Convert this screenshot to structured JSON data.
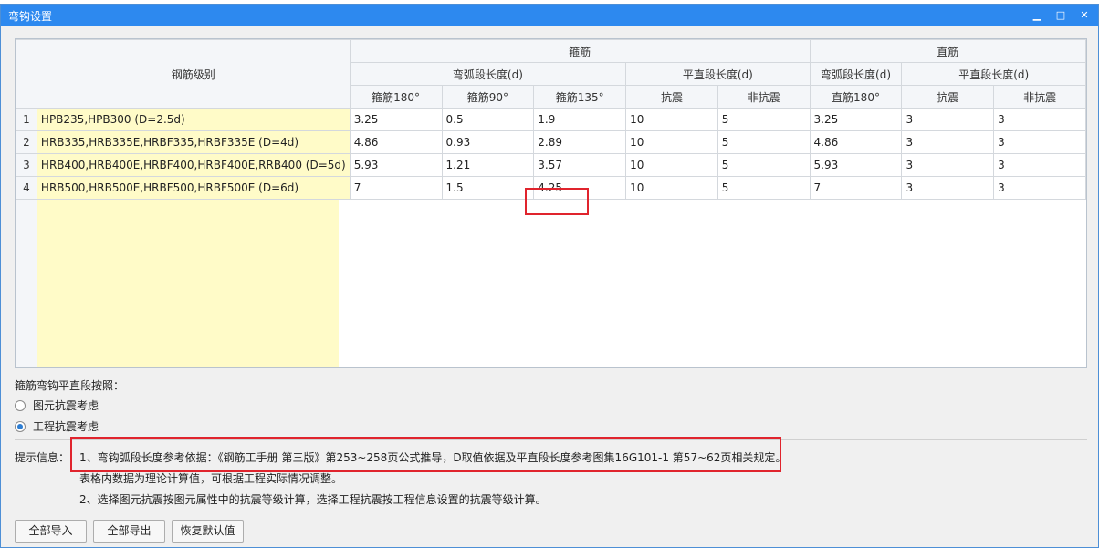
{
  "window": {
    "title": "弯钩设置",
    "min_icon": "minimize-icon",
    "max_icon": "maximize-icon",
    "close_icon": "close-icon"
  },
  "table": {
    "header_grade": "钢筋级别",
    "group_stirrup": "箍筋",
    "group_straight": "直筋",
    "sub_arc": "弯弧段长度(d)",
    "sub_flat": "平直段长度(d)",
    "sub_arc_straight": "弯弧段长度(d)",
    "sub_flat_straight": "平直段长度(d)",
    "columns": [
      "箍筋180°",
      "箍筋90°",
      "箍筋135°",
      "抗震",
      "非抗震",
      "直筋180°",
      "抗震",
      "非抗震"
    ],
    "rows": [
      {
        "num": "1",
        "grade": "HPB235,HPB300 (D=2.5d)",
        "values": [
          "3.25",
          "0.5",
          "1.9",
          "10",
          "5",
          "3.25",
          "3",
          "3"
        ]
      },
      {
        "num": "2",
        "grade": "HRB335,HRB335E,HRBF335,HRBF335E (D=4d)",
        "values": [
          "4.86",
          "0.93",
          "2.89",
          "10",
          "5",
          "4.86",
          "3",
          "3"
        ]
      },
      {
        "num": "3",
        "grade": "HRB400,HRB400E,HRBF400,HRBF400E,RRB400 (D=5d)",
        "values": [
          "5.93",
          "1.21",
          "3.57",
          "10",
          "5",
          "5.93",
          "3",
          "3"
        ]
      },
      {
        "num": "4",
        "grade": "HRB500,HRB500E,HRBF500,HRBF500E (D=6d)",
        "values": [
          "7",
          "1.5",
          "4.25",
          "10",
          "5",
          "7",
          "3",
          "3"
        ]
      }
    ]
  },
  "options": {
    "label": "箍筋弯钩平直段按照：",
    "radio1": "图元抗震考虑",
    "radio2": "工程抗震考虑",
    "selected": "工程抗震考虑"
  },
  "info": {
    "label": "提示信息：",
    "line1": "1、弯钩弧段长度参考依据：《钢筋工手册 第三版》第253~258页公式推导，D取值依据及平直段长度参考图集16G101-1 第57~62页相关规定。",
    "line2": "表格内数据为理论计算值，可根据工程实际情况调整。",
    "line3": "2、选择图元抗震按图元属性中的抗震等级计算，选择工程抗震按工程信息设置的抗震等级计算。"
  },
  "buttons": {
    "import_all": "全部导入",
    "export_all": "全部导出",
    "restore_default": "恢复默认值"
  },
  "colors": {
    "titlebar": "#2d89ef",
    "grade_cell": "#fffbc8",
    "highlight": "#e0242d",
    "radio_on": "#2d7dd2"
  }
}
